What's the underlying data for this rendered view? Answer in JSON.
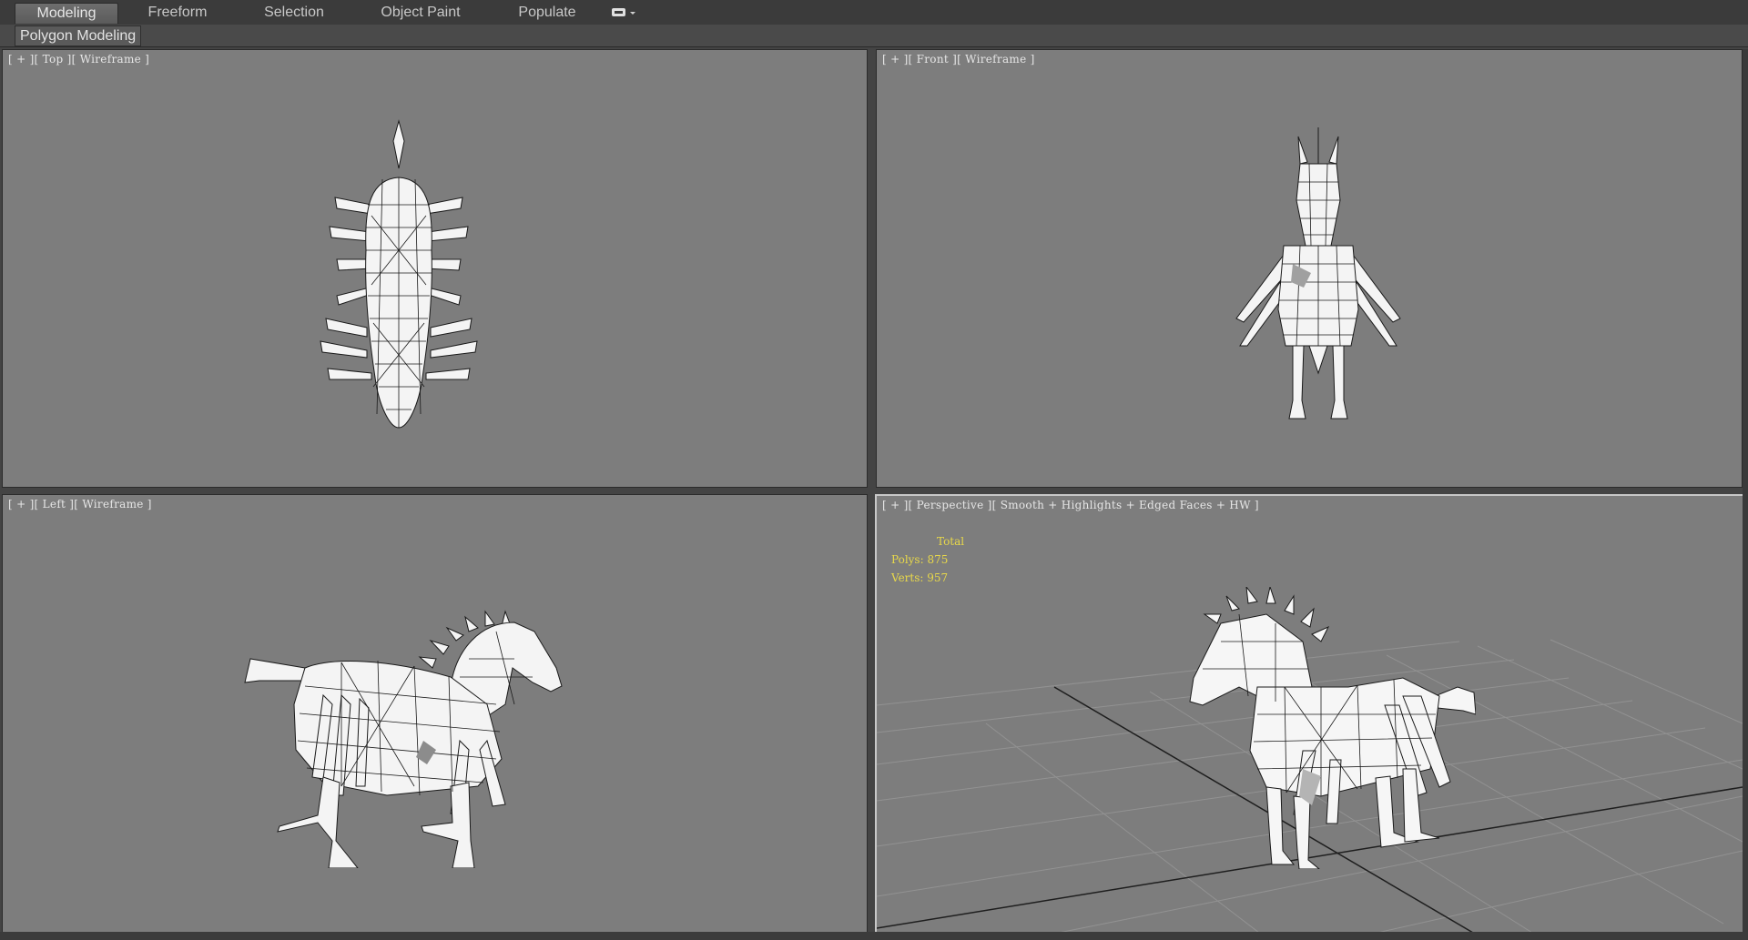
{
  "ribbon": {
    "tabs": [
      {
        "label": "Modeling",
        "active": true
      },
      {
        "label": "Freeform",
        "active": false
      },
      {
        "label": "Selection",
        "active": false
      },
      {
        "label": "Object Paint",
        "active": false
      },
      {
        "label": "Populate",
        "active": false
      }
    ],
    "options_icon": "display-options-icon",
    "sub_tab_label": "Polygon Modeling"
  },
  "viewports": {
    "top": {
      "label": "[ + ][ Top ][ Wireframe ]"
    },
    "front": {
      "label": "[ + ][ Front ][ Wireframe ]"
    },
    "left": {
      "label": "[ + ][ Left ][ Wireframe ]"
    },
    "perspective": {
      "label": "[ + ][ Perspective ][ Smooth + Highlights + Edged Faces + HW ]",
      "stats": {
        "header": "Total",
        "polys": "Polys:  875",
        "verts": "Verts:  957"
      }
    }
  },
  "colors": {
    "viewport_bg": "#7d7d7d",
    "stats_text": "#e8d84a",
    "active_border": "#c8c8c8"
  }
}
